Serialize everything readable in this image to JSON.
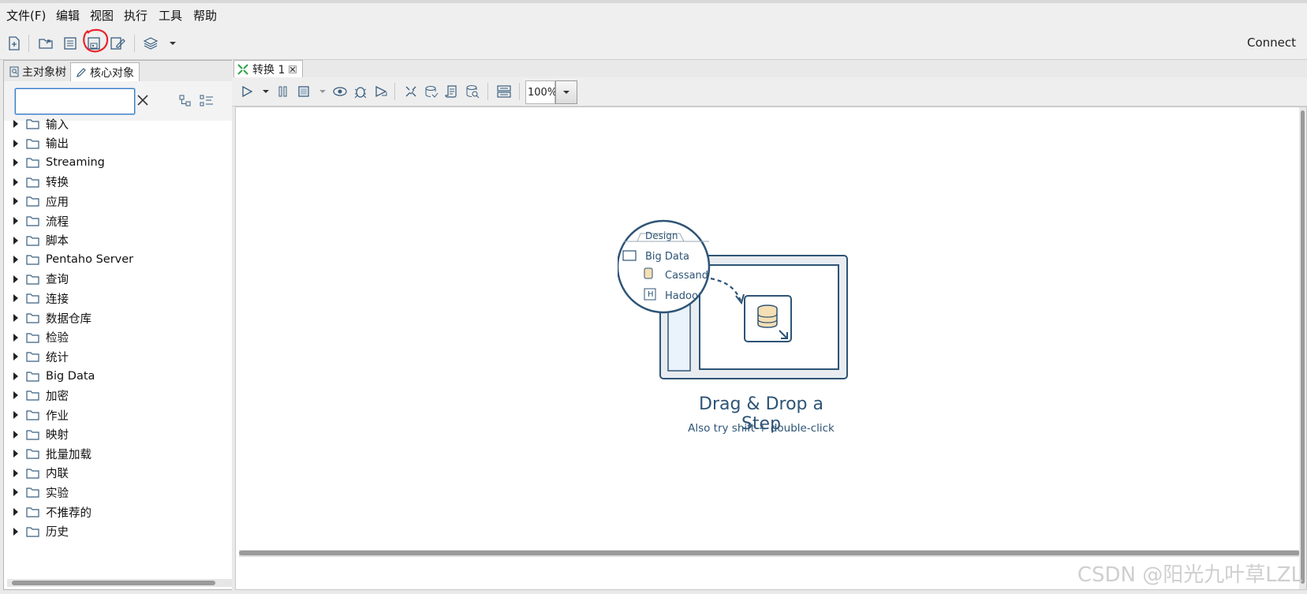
{
  "menu": [
    "文件(F)",
    "编辑",
    "视图",
    "执行",
    "工具",
    "帮助"
  ],
  "toolbar": {
    "connect_label": "Connect",
    "icons": [
      "new-file-icon",
      "open-icon",
      "explore-repo-icon",
      "save-icon",
      "save-as-icon",
      "layers-icon",
      "dropdown-icon"
    ]
  },
  "left_panel": {
    "tabs": [
      {
        "label": "主对象树",
        "icon": "search-icon"
      },
      {
        "label": "核心对象",
        "icon": "pencil-icon"
      }
    ],
    "search": {
      "value": "",
      "placeholder": ""
    },
    "tree_items": [
      "输入",
      "输出",
      "Streaming",
      "转换",
      "应用",
      "流程",
      "脚本",
      "Pentaho Server",
      "查询",
      "连接",
      "数据仓库",
      "检验",
      "统计",
      "Big Data",
      "加密",
      "作业",
      "映射",
      "批量加载",
      "内联",
      "实验",
      "不推荐的",
      "历史"
    ]
  },
  "editor": {
    "tab_label": "转换 1",
    "zoom": "100%",
    "illustration": {
      "design_tab": "Design",
      "folder": "Big Data",
      "item1": "Cassandr",
      "item2": "Hadoop",
      "hadoop_badge": "H"
    },
    "dd_title": "Drag & Drop a Step",
    "dd_subtitle": "Also try shift + double-click"
  },
  "watermark": "CSDN @阳光九叶草LZL",
  "colors": {
    "accent": "#2e5476",
    "highlight_circle": "#e8262b",
    "tab_icon_green": "#2ea04a"
  }
}
